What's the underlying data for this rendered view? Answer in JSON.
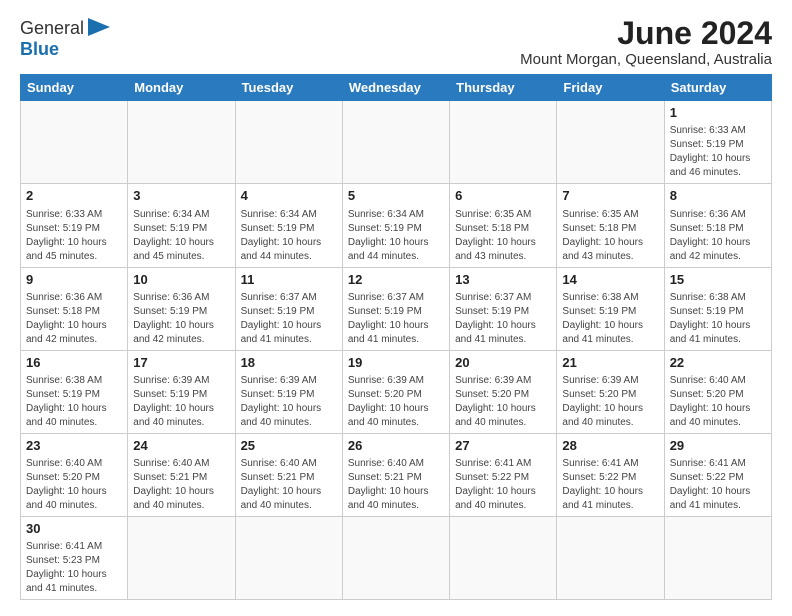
{
  "header": {
    "logo_general": "General",
    "logo_blue": "Blue",
    "month_year": "June 2024",
    "location": "Mount Morgan, Queensland, Australia"
  },
  "days_of_week": [
    "Sunday",
    "Monday",
    "Tuesday",
    "Wednesday",
    "Thursday",
    "Friday",
    "Saturday"
  ],
  "weeks": [
    [
      {
        "day": "",
        "info": ""
      },
      {
        "day": "",
        "info": ""
      },
      {
        "day": "",
        "info": ""
      },
      {
        "day": "",
        "info": ""
      },
      {
        "day": "",
        "info": ""
      },
      {
        "day": "",
        "info": ""
      },
      {
        "day": "1",
        "info": "Sunrise: 6:33 AM\nSunset: 5:19 PM\nDaylight: 10 hours and 46 minutes."
      }
    ],
    [
      {
        "day": "2",
        "info": "Sunrise: 6:33 AM\nSunset: 5:19 PM\nDaylight: 10 hours and 45 minutes."
      },
      {
        "day": "3",
        "info": "Sunrise: 6:34 AM\nSunset: 5:19 PM\nDaylight: 10 hours and 45 minutes."
      },
      {
        "day": "4",
        "info": "Sunrise: 6:34 AM\nSunset: 5:19 PM\nDaylight: 10 hours and 44 minutes."
      },
      {
        "day": "5",
        "info": "Sunrise: 6:34 AM\nSunset: 5:19 PM\nDaylight: 10 hours and 44 minutes."
      },
      {
        "day": "6",
        "info": "Sunrise: 6:35 AM\nSunset: 5:18 PM\nDaylight: 10 hours and 43 minutes."
      },
      {
        "day": "7",
        "info": "Sunrise: 6:35 AM\nSunset: 5:18 PM\nDaylight: 10 hours and 43 minutes."
      },
      {
        "day": "8",
        "info": "Sunrise: 6:36 AM\nSunset: 5:18 PM\nDaylight: 10 hours and 42 minutes."
      }
    ],
    [
      {
        "day": "9",
        "info": "Sunrise: 6:36 AM\nSunset: 5:18 PM\nDaylight: 10 hours and 42 minutes."
      },
      {
        "day": "10",
        "info": "Sunrise: 6:36 AM\nSunset: 5:19 PM\nDaylight: 10 hours and 42 minutes."
      },
      {
        "day": "11",
        "info": "Sunrise: 6:37 AM\nSunset: 5:19 PM\nDaylight: 10 hours and 41 minutes."
      },
      {
        "day": "12",
        "info": "Sunrise: 6:37 AM\nSunset: 5:19 PM\nDaylight: 10 hours and 41 minutes."
      },
      {
        "day": "13",
        "info": "Sunrise: 6:37 AM\nSunset: 5:19 PM\nDaylight: 10 hours and 41 minutes."
      },
      {
        "day": "14",
        "info": "Sunrise: 6:38 AM\nSunset: 5:19 PM\nDaylight: 10 hours and 41 minutes."
      },
      {
        "day": "15",
        "info": "Sunrise: 6:38 AM\nSunset: 5:19 PM\nDaylight: 10 hours and 41 minutes."
      }
    ],
    [
      {
        "day": "16",
        "info": "Sunrise: 6:38 AM\nSunset: 5:19 PM\nDaylight: 10 hours and 40 minutes."
      },
      {
        "day": "17",
        "info": "Sunrise: 6:39 AM\nSunset: 5:19 PM\nDaylight: 10 hours and 40 minutes."
      },
      {
        "day": "18",
        "info": "Sunrise: 6:39 AM\nSunset: 5:19 PM\nDaylight: 10 hours and 40 minutes."
      },
      {
        "day": "19",
        "info": "Sunrise: 6:39 AM\nSunset: 5:20 PM\nDaylight: 10 hours and 40 minutes."
      },
      {
        "day": "20",
        "info": "Sunrise: 6:39 AM\nSunset: 5:20 PM\nDaylight: 10 hours and 40 minutes."
      },
      {
        "day": "21",
        "info": "Sunrise: 6:39 AM\nSunset: 5:20 PM\nDaylight: 10 hours and 40 minutes."
      },
      {
        "day": "22",
        "info": "Sunrise: 6:40 AM\nSunset: 5:20 PM\nDaylight: 10 hours and 40 minutes."
      }
    ],
    [
      {
        "day": "23",
        "info": "Sunrise: 6:40 AM\nSunset: 5:20 PM\nDaylight: 10 hours and 40 minutes."
      },
      {
        "day": "24",
        "info": "Sunrise: 6:40 AM\nSunset: 5:21 PM\nDaylight: 10 hours and 40 minutes."
      },
      {
        "day": "25",
        "info": "Sunrise: 6:40 AM\nSunset: 5:21 PM\nDaylight: 10 hours and 40 minutes."
      },
      {
        "day": "26",
        "info": "Sunrise: 6:40 AM\nSunset: 5:21 PM\nDaylight: 10 hours and 40 minutes."
      },
      {
        "day": "27",
        "info": "Sunrise: 6:41 AM\nSunset: 5:22 PM\nDaylight: 10 hours and 40 minutes."
      },
      {
        "day": "28",
        "info": "Sunrise: 6:41 AM\nSunset: 5:22 PM\nDaylight: 10 hours and 41 minutes."
      },
      {
        "day": "29",
        "info": "Sunrise: 6:41 AM\nSunset: 5:22 PM\nDaylight: 10 hours and 41 minutes."
      }
    ],
    [
      {
        "day": "30",
        "info": "Sunrise: 6:41 AM\nSunset: 5:23 PM\nDaylight: 10 hours and 41 minutes."
      },
      {
        "day": "",
        "info": ""
      },
      {
        "day": "",
        "info": ""
      },
      {
        "day": "",
        "info": ""
      },
      {
        "day": "",
        "info": ""
      },
      {
        "day": "",
        "info": ""
      },
      {
        "day": "",
        "info": ""
      }
    ]
  ]
}
